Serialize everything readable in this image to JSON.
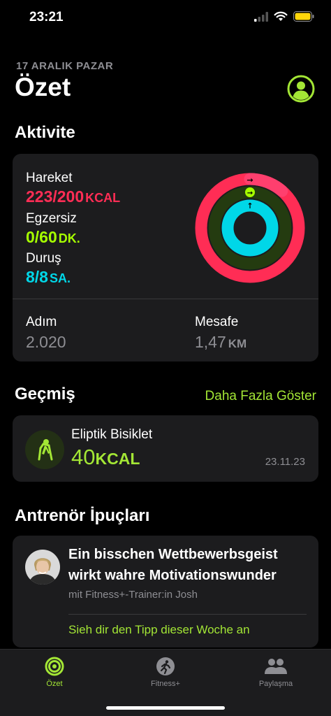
{
  "status_bar": {
    "time": "23:21"
  },
  "header": {
    "date": "17 ARALIK PAZAR",
    "title": "Özet"
  },
  "activity": {
    "section_title": "Aktivite",
    "move": {
      "label": "Hareket",
      "value": "223/200",
      "unit": "KCAL",
      "color": "#ff2d55",
      "fraction": 1.115
    },
    "exercise": {
      "label": "Egzersiz",
      "value": "0/60",
      "unit": "DK.",
      "color": "#a6ff00",
      "fraction": 0
    },
    "stand": {
      "label": "Duruş",
      "value": "8/8",
      "unit": "SA.",
      "color": "#00d7e8",
      "fraction": 1
    },
    "steps": {
      "label": "Adım",
      "value": "2.020"
    },
    "distance": {
      "label": "Mesafe",
      "value": "1,47",
      "unit": "KM"
    }
  },
  "history": {
    "section_title": "Geçmiş",
    "more_link": "Daha Fazla Göster",
    "item": {
      "name": "Eliptik Bisiklet",
      "value": "40",
      "unit": "KCAL",
      "date": "23.11.23"
    }
  },
  "tips": {
    "section_title": "Antrenör İpuçları",
    "title": "Ein bisschen Wettbewerbsgeist wirkt wahre Motivationswunder",
    "subtitle": "mit Fitness+-Trainer:in Josh",
    "link": "Sieh dir den Tipp dieser Woche an"
  },
  "tab_bar": {
    "tabs": [
      {
        "label": "Özet",
        "active": true
      },
      {
        "label": "Fitness+",
        "active": false
      },
      {
        "label": "Paylaşma",
        "active": false
      }
    ]
  },
  "colors": {
    "accent": "#a3e635",
    "background": "#000000",
    "card": "#1c1c1e"
  }
}
